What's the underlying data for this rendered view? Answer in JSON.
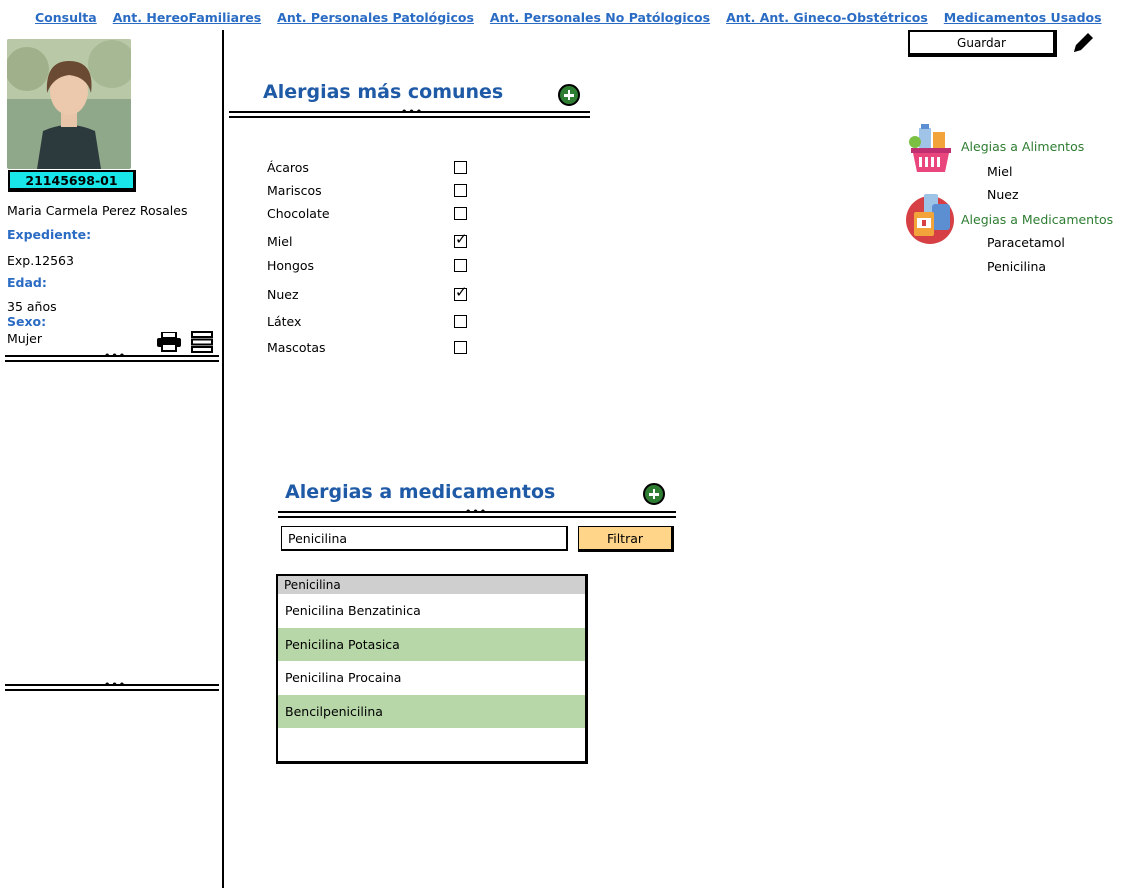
{
  "nav": {
    "tabs": [
      "Consulta",
      "Ant. HereoFamiliares",
      "Ant. Personales Patológicos",
      "Ant. Personales No Patólogicos",
      "Ant.  Ant. Gineco-Obstétricos",
      "Medicamentos Usados"
    ]
  },
  "toolbar": {
    "save_label": "Guardar",
    "edit_icon": "pencil-icon"
  },
  "patient": {
    "id": "21145698-01",
    "name": "Maria Carmela Perez Rosales",
    "expediente_label": "Expediente:",
    "expediente_value": "Exp.12563",
    "edad_label": "Edad:",
    "edad_value": "35 años",
    "sexo_label": "Sexo:",
    "sexo_value": "Mujer",
    "icons": [
      "printer-icon",
      "list-icon"
    ]
  },
  "common_allergies": {
    "title": "Alergias más comunes",
    "items": [
      {
        "label": "Ácaros",
        "checked": false
      },
      {
        "label": "Mariscos",
        "checked": false
      },
      {
        "label": "Chocolate",
        "checked": false
      },
      {
        "label": "Miel",
        "checked": true
      },
      {
        "label": "Hongos",
        "checked": false
      },
      {
        "label": "Nuez",
        "checked": true
      },
      {
        "label": "Látex",
        "checked": false
      },
      {
        "label": "Mascotas",
        "checked": false
      }
    ]
  },
  "summary": {
    "food_title": "Alegias a Alimentos",
    "food_items": [
      "Miel",
      "Nuez"
    ],
    "med_title": "Alegias a Medicamentos",
    "med_items": [
      "Paracetamol",
      "Penicilina"
    ],
    "colors": {
      "title": "#2e7d32"
    }
  },
  "med_allergies": {
    "title": "Alergias a medicamentos",
    "search_value": "Penicilina",
    "filter_label": "Filtrar",
    "list_header": "Penicilina",
    "results": [
      "Penicilina Benzatinica",
      "Penicilina Potasica",
      "Penicilina Procaina",
      "Bencilpenicilina"
    ]
  },
  "colors": {
    "accent": "#1f5aa6",
    "link": "#2a6bc4",
    "badge": "#19e6e8",
    "filter": "#ffd58a",
    "row_alt": "#b7d7a8"
  }
}
